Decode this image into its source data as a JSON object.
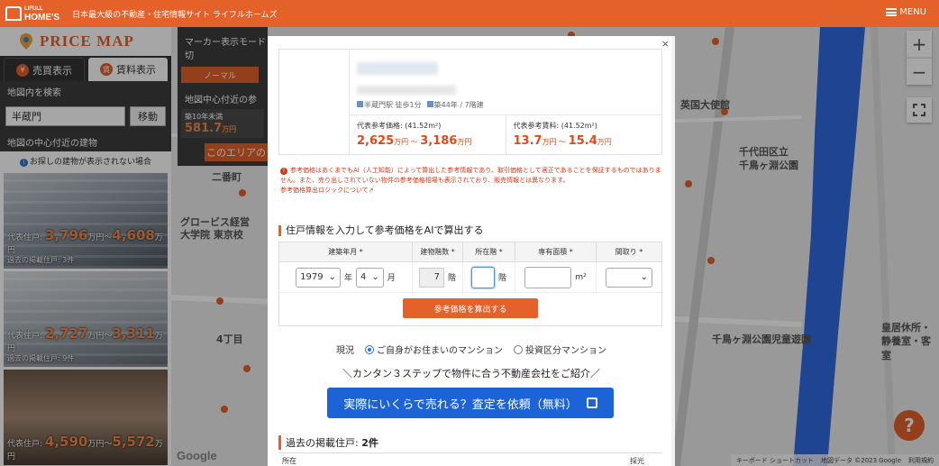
{
  "header": {
    "logo_small": "LIFULL",
    "logo_big": "HOME'S",
    "tagline": "日本最大級の不動産・住宅情報サイト ライフルホームズ",
    "menu": "MENU"
  },
  "sidebar": {
    "title": "PRICE MAP",
    "tabs": [
      {
        "icon": "¥",
        "label": "売買表示"
      },
      {
        "icon": "賃",
        "label": "賃料表示"
      }
    ],
    "search_section": "地図内を検索",
    "search_value": "半蔵門",
    "search_button": "移動",
    "nearby_section": "地図の中心付近の建物",
    "note": "お探しの建物が表示されない場合",
    "listings": [
      {
        "label": "代表住戸:",
        "low": "3,796",
        "high": "4,608",
        "unit": "万円",
        "sep": "～",
        "sub": "過去の掲載住戸: 3件"
      },
      {
        "label": "代表住戸:",
        "low": "2,727",
        "high": "3,311",
        "unit": "万円",
        "sep": "～",
        "sub": "過去の掲載住戸: 9件"
      },
      {
        "label": "代表住戸:",
        "low": "4,590",
        "high": "5,572",
        "unit": "万円",
        "sep": "～",
        "sub": ""
      }
    ]
  },
  "panel2": {
    "marker_title": "マーカー表示モード切",
    "mode_normal": "ノーマル",
    "center_title": "地図中心付近の参",
    "box_label": "築10年未満",
    "box_price": "581.7",
    "box_unit": "万円",
    "area_button": "このエリアの"
  },
  "map": {
    "labels": [
      "英国大使館",
      "千代田区立",
      "千鳥ヶ淵公園",
      "千鳥ヶ淵公園児童遊園",
      "皇居休所・",
      "静養室・客室",
      "二番町",
      "グロービス経営",
      "大学院 東京校",
      "4丁目"
    ],
    "zoom_in": "+",
    "zoom_out": "−",
    "help": "?",
    "google": "Google",
    "footer": [
      "キーボード ショートカット",
      "地図データ ©2023 Google",
      "利用規約"
    ]
  },
  "modal": {
    "close": "×",
    "station": "半蔵門駅 徒歩1分",
    "age": "築44年 / 7階建",
    "sale_label": "代表参考価格: (41.52m²)",
    "sale_low": "2,625",
    "sale_high": "3,186",
    "rent_label": "代表参考賃料: (41.52m²)",
    "rent_low": "13.7",
    "rent_high": "15.4",
    "unit": "万円",
    "sep": " ～ ",
    "warning": "参考価格はあくまでもAI（人工知能）によって算出した参考情報であり、取引価格として適正であることを保証するものではありません。また、売り出しされていない物件の参考価格相場も表示されており、販売情報とは異なります。",
    "warning_link": "参考価格算出ロジックについて",
    "form_title": "住戸情報を入力して参考価格をAIで算出する",
    "form_headers": [
      "建築年月 *",
      "建物階数 *",
      "所在階 *",
      "専有面積 *",
      "間取り *"
    ],
    "year": "1979",
    "year_unit": "年",
    "month": "4",
    "month_unit": "月",
    "floors": "7",
    "floor_unit": "階",
    "area_unit": "m²",
    "calc_button": "参考価格を算出する",
    "status_label": "現況",
    "radio_self": "ご自身がお住まいのマンション",
    "radio_invest": "投資区分マンション",
    "intro": "＼カンタン３ステップで物件に合う不動産会社をご紹介／",
    "cta": "実際にいくらで売れる？査定を依頼（無料）",
    "past_title": "過去の掲載住戸:",
    "past_count": "2件",
    "past_cols": [
      "所在",
      "",
      "",
      "",
      "採光"
    ]
  }
}
